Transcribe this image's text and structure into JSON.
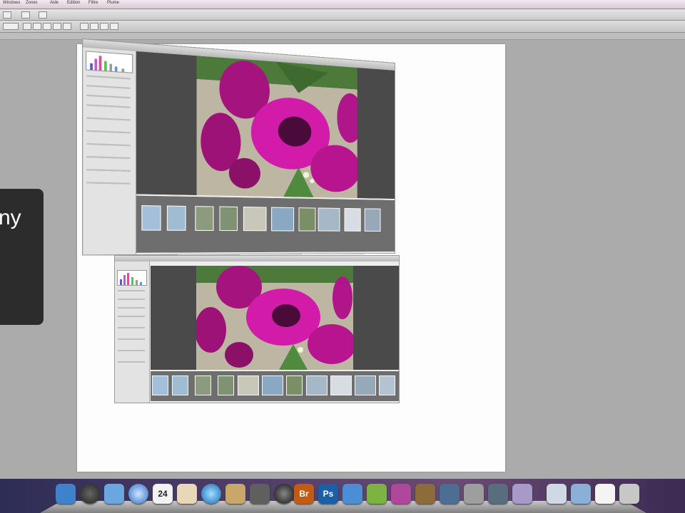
{
  "menubar": {
    "items": [
      "Windows",
      "Zones",
      "Aide",
      "Edition",
      "Filtre",
      "Plume"
    ]
  },
  "callout": {
    "text": "ny",
    "text2": ","
  },
  "dock": {
    "bridge_label": "Br",
    "photoshop_label": "Ps",
    "calendar_label": "24",
    "colors": {
      "bridge": "#c45a14",
      "photoshop": "#1a5fa8",
      "finder": "#3f82cc"
    }
  },
  "colors": {
    "callout_bg": "#2c2c2c",
    "flower": "#c0179b",
    "viewer_bg": "#4a4a4a"
  }
}
